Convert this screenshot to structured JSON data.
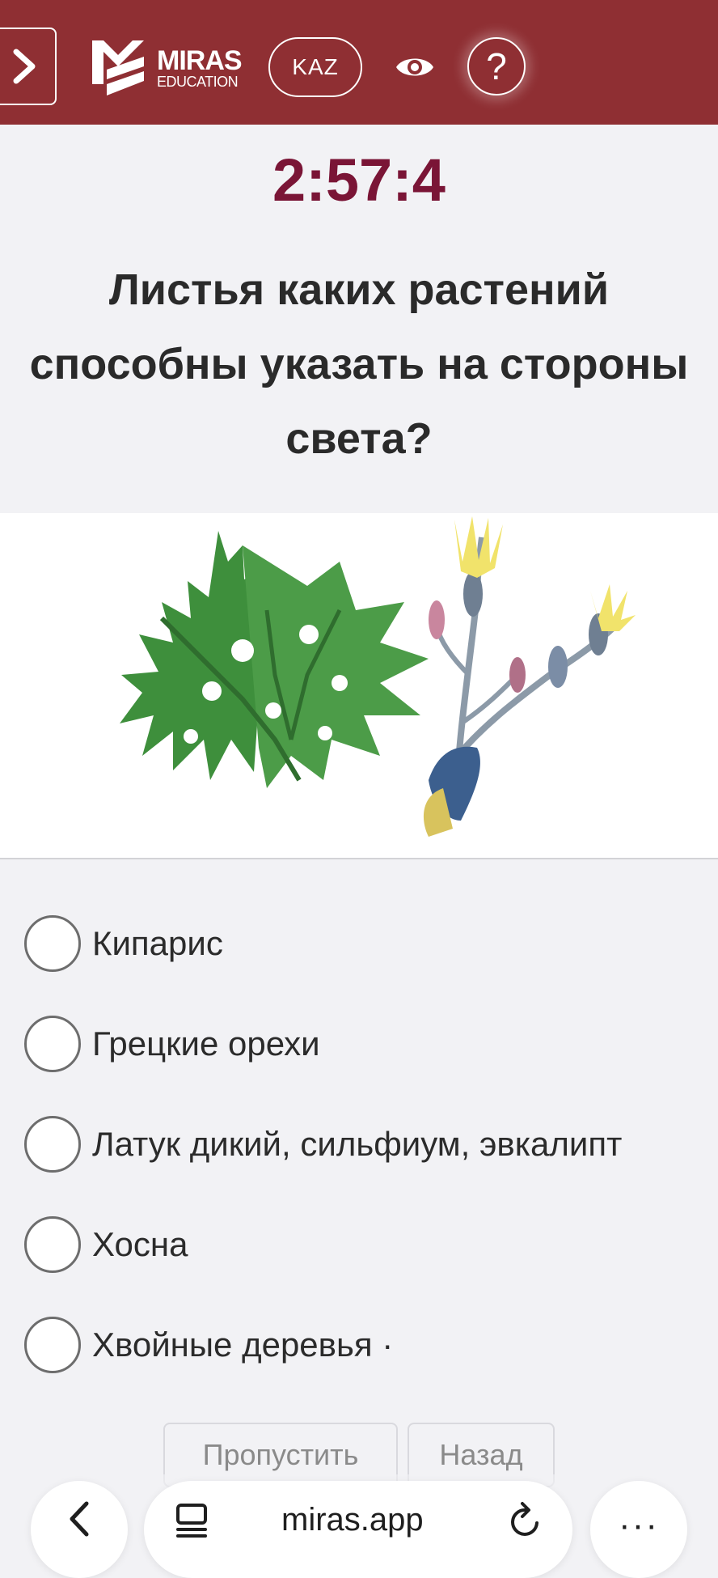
{
  "header": {
    "logo": {
      "title": "MIRAS",
      "subtitle": "EDUCATION"
    },
    "lang_label": "KAZ",
    "help_label": "?",
    "icons": {
      "menu": "chevron-right-icon",
      "eye": "eye-icon"
    }
  },
  "timer": "2:57:4",
  "question": {
    "text": "Листья каких растений\nспособны указать на стороны\nсвета?"
  },
  "illustration": {
    "subject": "plant-illustration"
  },
  "options": [
    {
      "label": "Кипарис"
    },
    {
      "label": "Грецкие орехи"
    },
    {
      "label": "Латук дикий, сильфиум, эвкалипт"
    },
    {
      "label": "Хосна"
    },
    {
      "label": "Хвойные деревья ·"
    }
  ],
  "actions": {
    "skip_label": "Пропустить",
    "back_label": "Назад"
  },
  "browser": {
    "url": "miras.app",
    "more_label": "···",
    "icons": {
      "back": "chevron-left-icon",
      "reader": "reader-icon",
      "reload": "reload-icon"
    }
  },
  "colors": {
    "header_bg": "#8f2f33",
    "timer": "#7a1536",
    "page_bg": "#f2f2f5"
  }
}
